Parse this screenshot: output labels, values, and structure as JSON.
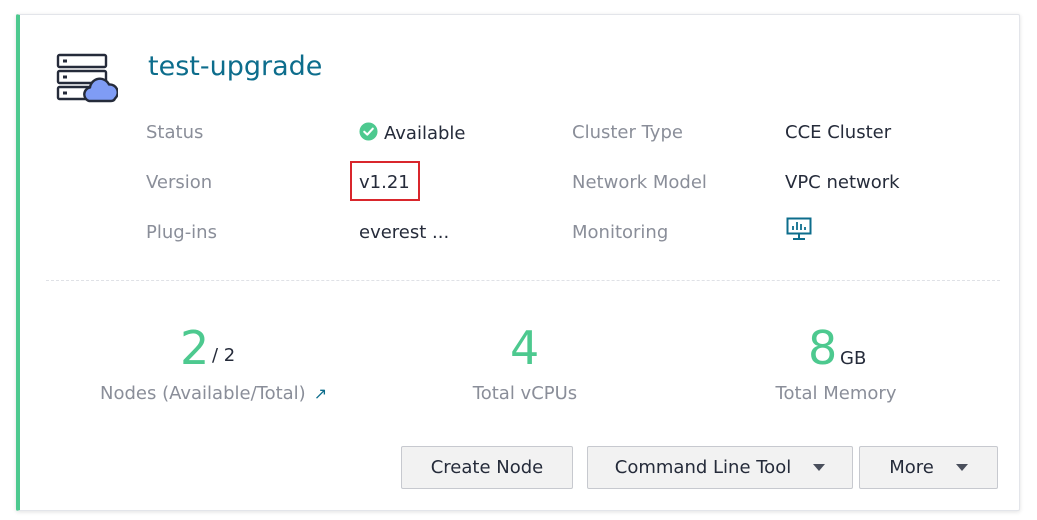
{
  "cluster": {
    "name": "test-upgrade"
  },
  "details": {
    "status_label": "Status",
    "status_value": "Available",
    "version_label": "Version",
    "version_value": "v1.21",
    "plugins_label": "Plug-ins",
    "plugins_value": "everest ...",
    "cluster_type_label": "Cluster Type",
    "cluster_type_value": "CCE Cluster",
    "network_model_label": "Network Model",
    "network_model_value": "VPC network",
    "monitoring_label": "Monitoring",
    "monitoring_icon": "monitor-chart-icon"
  },
  "stats": {
    "nodes_available": "2",
    "nodes_total": "/ 2",
    "nodes_label": "Nodes (Available/Total)",
    "vcpus_value": "4",
    "vcpus_label": "Total vCPUs",
    "memory_value": "8",
    "memory_unit": "GB",
    "memory_label": "Total Memory"
  },
  "actions": {
    "create_node": "Create Node",
    "command_line_tool": "Command Line Tool",
    "more": "More"
  },
  "colors": {
    "accent_green": "#4dc98f",
    "title_blue": "#0d6d8c",
    "highlight_red": "#d9262c"
  }
}
